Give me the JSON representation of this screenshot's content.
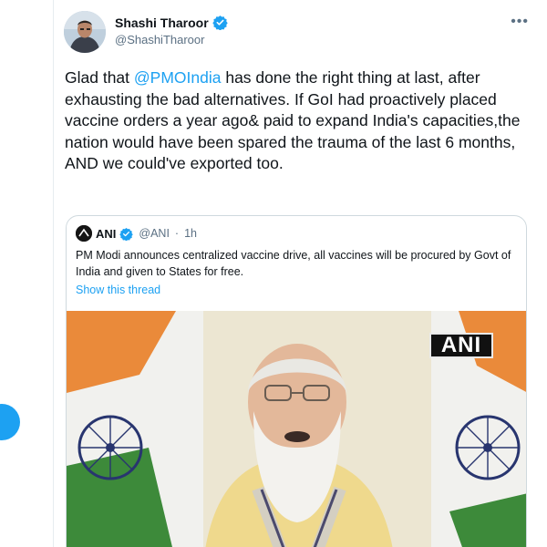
{
  "tweet": {
    "author_name": "Shashi Tharoor",
    "author_handle": "@ShashiTharoor",
    "text_before_mention": "Glad that ",
    "mention": "@PMOIndia",
    "text_after_mention": " has done the right thing at last, after exhausting the bad alternatives. If GoI had proactively placed vaccine orders a year ago& paid to expand India's capacities,the nation would have been spared the trauma of the last 6 months, AND we could've exported too."
  },
  "quote": {
    "author_name": "ANI",
    "author_handle": "@ANI",
    "separator": "·",
    "time": "1h",
    "text": "PM Modi announces centralized vaccine drive, all vaccines will be procured by Govt of India and given to States for free.",
    "show_thread": "Show this thread",
    "media_watermark": "ANI"
  },
  "colors": {
    "accent": "#1da1f2",
    "secondary_text": "#5b7083",
    "border": "#cfd9de"
  },
  "icons": {
    "more": "more-horizontal-icon",
    "verified": "verified-badge-icon"
  }
}
